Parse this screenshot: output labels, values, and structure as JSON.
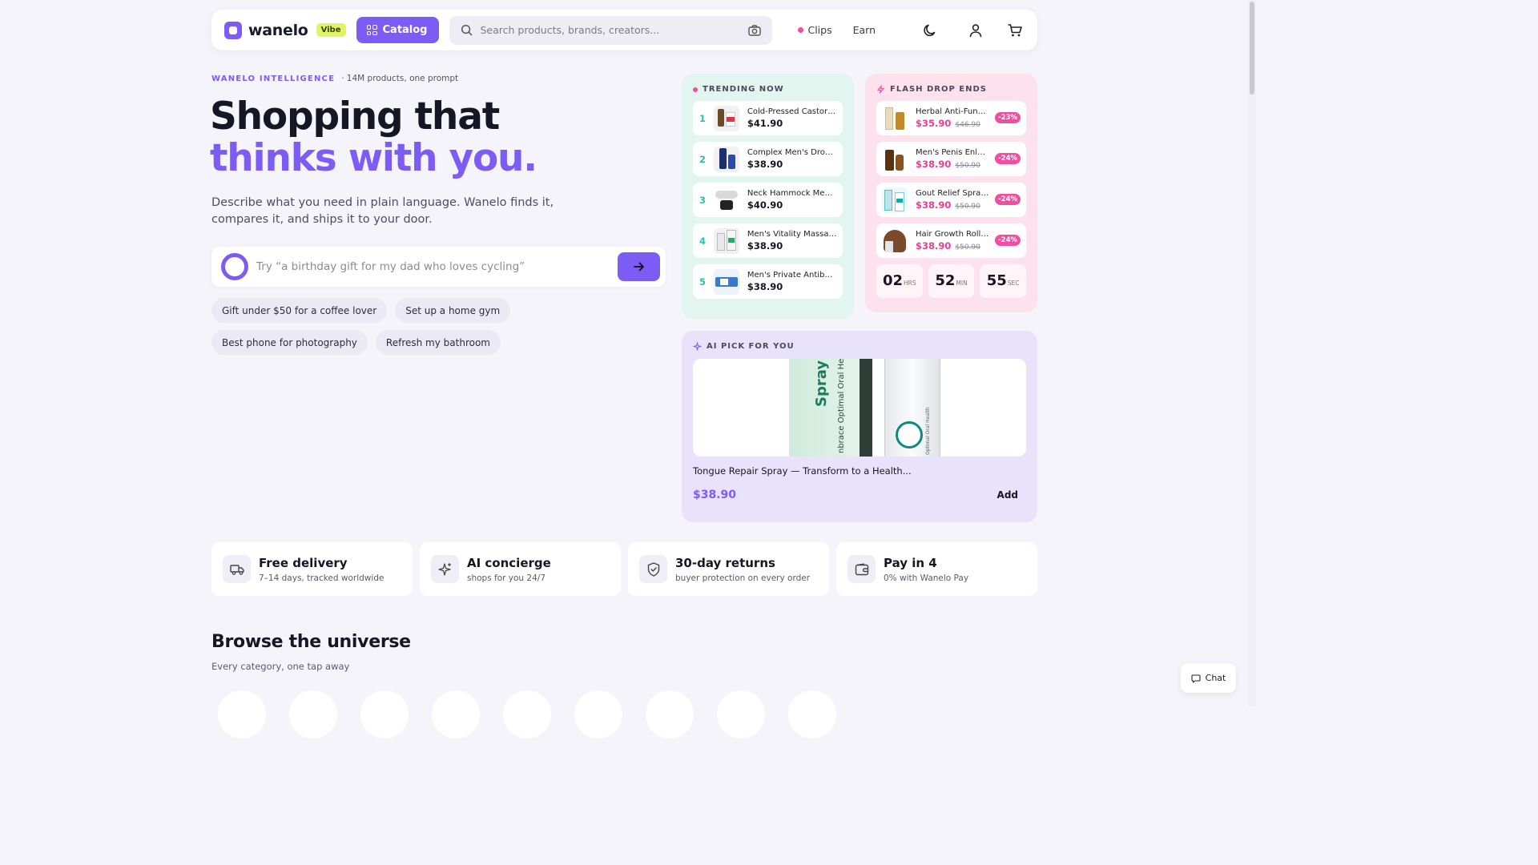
{
  "header": {
    "logo_text": "wanelo",
    "badge": "Vibe",
    "catalog_label": "Catalog",
    "search_placeholder": "Search products, brands, creators...",
    "clips_label": "Clips",
    "earn_label": "Earn",
    "icons": [
      "search-icon",
      "camera-icon",
      "moon-icon",
      "user-icon",
      "cart-icon"
    ]
  },
  "hero": {
    "eyebrow_brand": "WANELO INTELLIGENCE",
    "eyebrow_sub": "· 14M products, one prompt",
    "title_line1": "Shopping that",
    "title_line2": "thinks with you.",
    "lede": "Describe what you need in plain language. Wanelo finds it, compares it, and ships it to your door.",
    "prompt_placeholder": "Try “a birthday gift for my dad who loves cycling”",
    "chips": [
      "Gift under $50 for a coffee lover",
      "Set up a home gym",
      "Best phone for photography",
      "Refresh my bathroom"
    ]
  },
  "trending": {
    "title": "TRENDING NOW",
    "items": [
      {
        "rank": "1",
        "name": "Cold-Pressed Castor ...",
        "price": "$41.90"
      },
      {
        "rank": "2",
        "name": "Complex Men's Drops ...",
        "price": "$38.90"
      },
      {
        "rank": "3",
        "name": "Neck Hammock Memo...",
        "price": "$40.90"
      },
      {
        "rank": "4",
        "name": "Men's Vitality Massag...",
        "price": "$38.90"
      },
      {
        "rank": "5",
        "name": "Men's Private Antibac...",
        "price": "$38.90"
      }
    ]
  },
  "flash": {
    "title": "FLASH DROP ENDS",
    "items": [
      {
        "name": "Herbal Anti-Fung...",
        "price": "$35.90",
        "old": "$46.90",
        "badge": "-23%"
      },
      {
        "name": "Men's Penis Enlar...",
        "price": "$38.90",
        "old": "$50.90",
        "badge": "-24%"
      },
      {
        "name": "Gout Relief Spray...",
        "price": "$38.90",
        "old": "$50.90",
        "badge": "-24%"
      },
      {
        "name": "Hair Growth Rolle...",
        "price": "$38.90",
        "old": "$50.90",
        "badge": "-24%"
      }
    ],
    "timer": {
      "hrs": "02",
      "hrs_unit": "HRS",
      "min": "52",
      "min_unit": "MIN",
      "sec": "55",
      "sec_unit": "SEC"
    }
  },
  "ai_pick": {
    "title": "AI PICK FOR YOU",
    "product_name": "Tongue Repair Spray — Transform to a Health...",
    "price": "$38.90",
    "add_label": "Add",
    "image_text_spray": "Spray",
    "image_text_side": "nbrace Optimal Oral Hea",
    "image_text_bottle": "Optimal Oral Health"
  },
  "features": [
    {
      "icon": "truck-icon",
      "title": "Free delivery",
      "sub": "7–14 days, tracked worldwide"
    },
    {
      "icon": "sparkle-icon",
      "title": "AI concierge",
      "sub": "shops for you 24/7"
    },
    {
      "icon": "shield-icon",
      "title": "30-day returns",
      "sub": "buyer protection on every order"
    },
    {
      "icon": "wallet-icon",
      "title": "Pay in 4",
      "sub": "0% with Wanelo Pay"
    }
  ],
  "browse": {
    "title": "Browse the universe",
    "sub": "Every category, one tap away"
  },
  "chat": {
    "label": "Chat"
  },
  "colors": {
    "accent": "#7c5cf5",
    "pink": "#f04fa0",
    "teal": "#2dbfa6",
    "lime": "#dff562"
  }
}
